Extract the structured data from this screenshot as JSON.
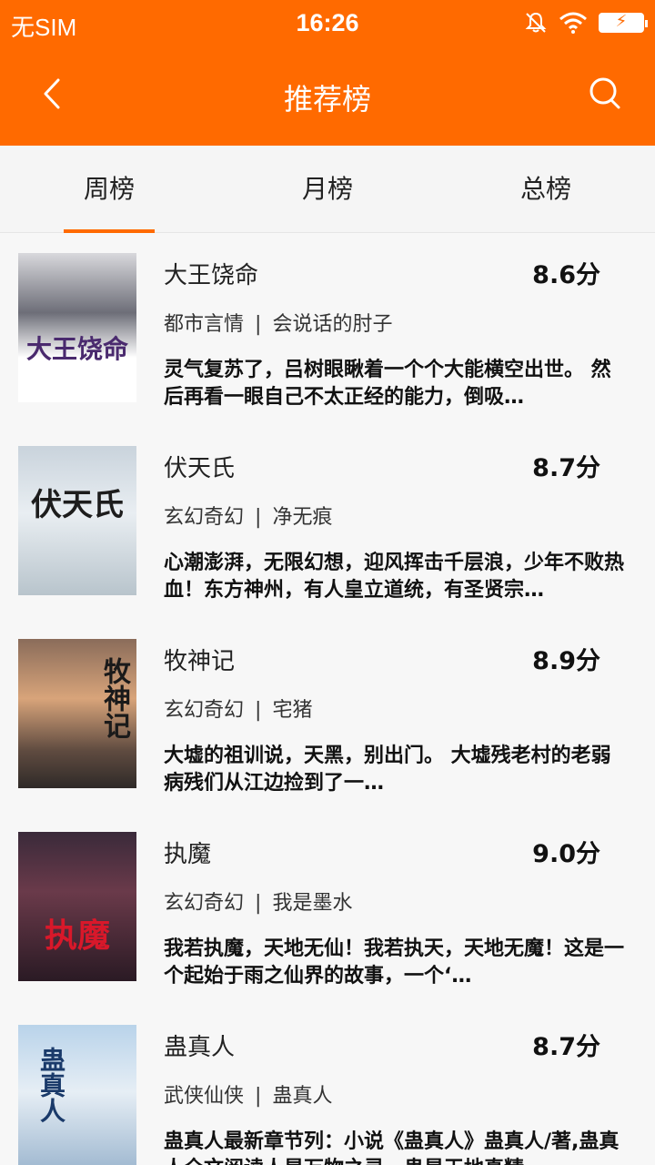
{
  "status": {
    "carrier": "无SIM",
    "time": "16:26",
    "battery_icon": "⚡"
  },
  "header": {
    "title": "推荐榜"
  },
  "tabs": [
    {
      "label": "周榜"
    },
    {
      "label": "月榜"
    },
    {
      "label": "总榜"
    }
  ],
  "books": [
    {
      "title": "大王饶命",
      "score": "8.6分",
      "category": "都市言情",
      "separator": "|",
      "author": "会说话的肘子",
      "description": "灵气复苏了，吕树眼瞅着一个个大能横空出世。 然后再看一眼自己不太正经的能力，倒吸…",
      "cover_text": "大王饶命"
    },
    {
      "title": "伏天氏",
      "score": "8.7分",
      "category": "玄幻奇幻",
      "separator": "|",
      "author": "净无痕",
      "description": "心潮澎湃，无限幻想，迎风挥击千层浪，少年不败热血！东方神州，有人皇立道统，有圣贤宗…",
      "cover_text": "伏天氏"
    },
    {
      "title": "牧神记",
      "score": "8.9分",
      "category": "玄幻奇幻",
      "separator": "|",
      "author": "宅猪",
      "description": "大墟的祖训说，天黑，别出门。 大墟残老村的老弱病残们从江边捡到了一…",
      "cover_text": "牧神记"
    },
    {
      "title": "执魔",
      "score": "9.0分",
      "category": "玄幻奇幻",
      "separator": "|",
      "author": "我是墨水",
      "description": "我若执魔，天地无仙！我若执天，天地无魔！这是一个起始于雨之仙界的故事，一个‘…",
      "cover_text": "执魔"
    },
    {
      "title": "蛊真人",
      "score": "8.7分",
      "category": "武侠仙侠",
      "separator": "|",
      "author": "蛊真人",
      "description": "蛊真人最新章节列：小说《蛊真人》蛊真人/著,蛊真人全文阅读人是万物之灵，蛊是天地真精…",
      "cover_text": "蛊真人"
    }
  ]
}
